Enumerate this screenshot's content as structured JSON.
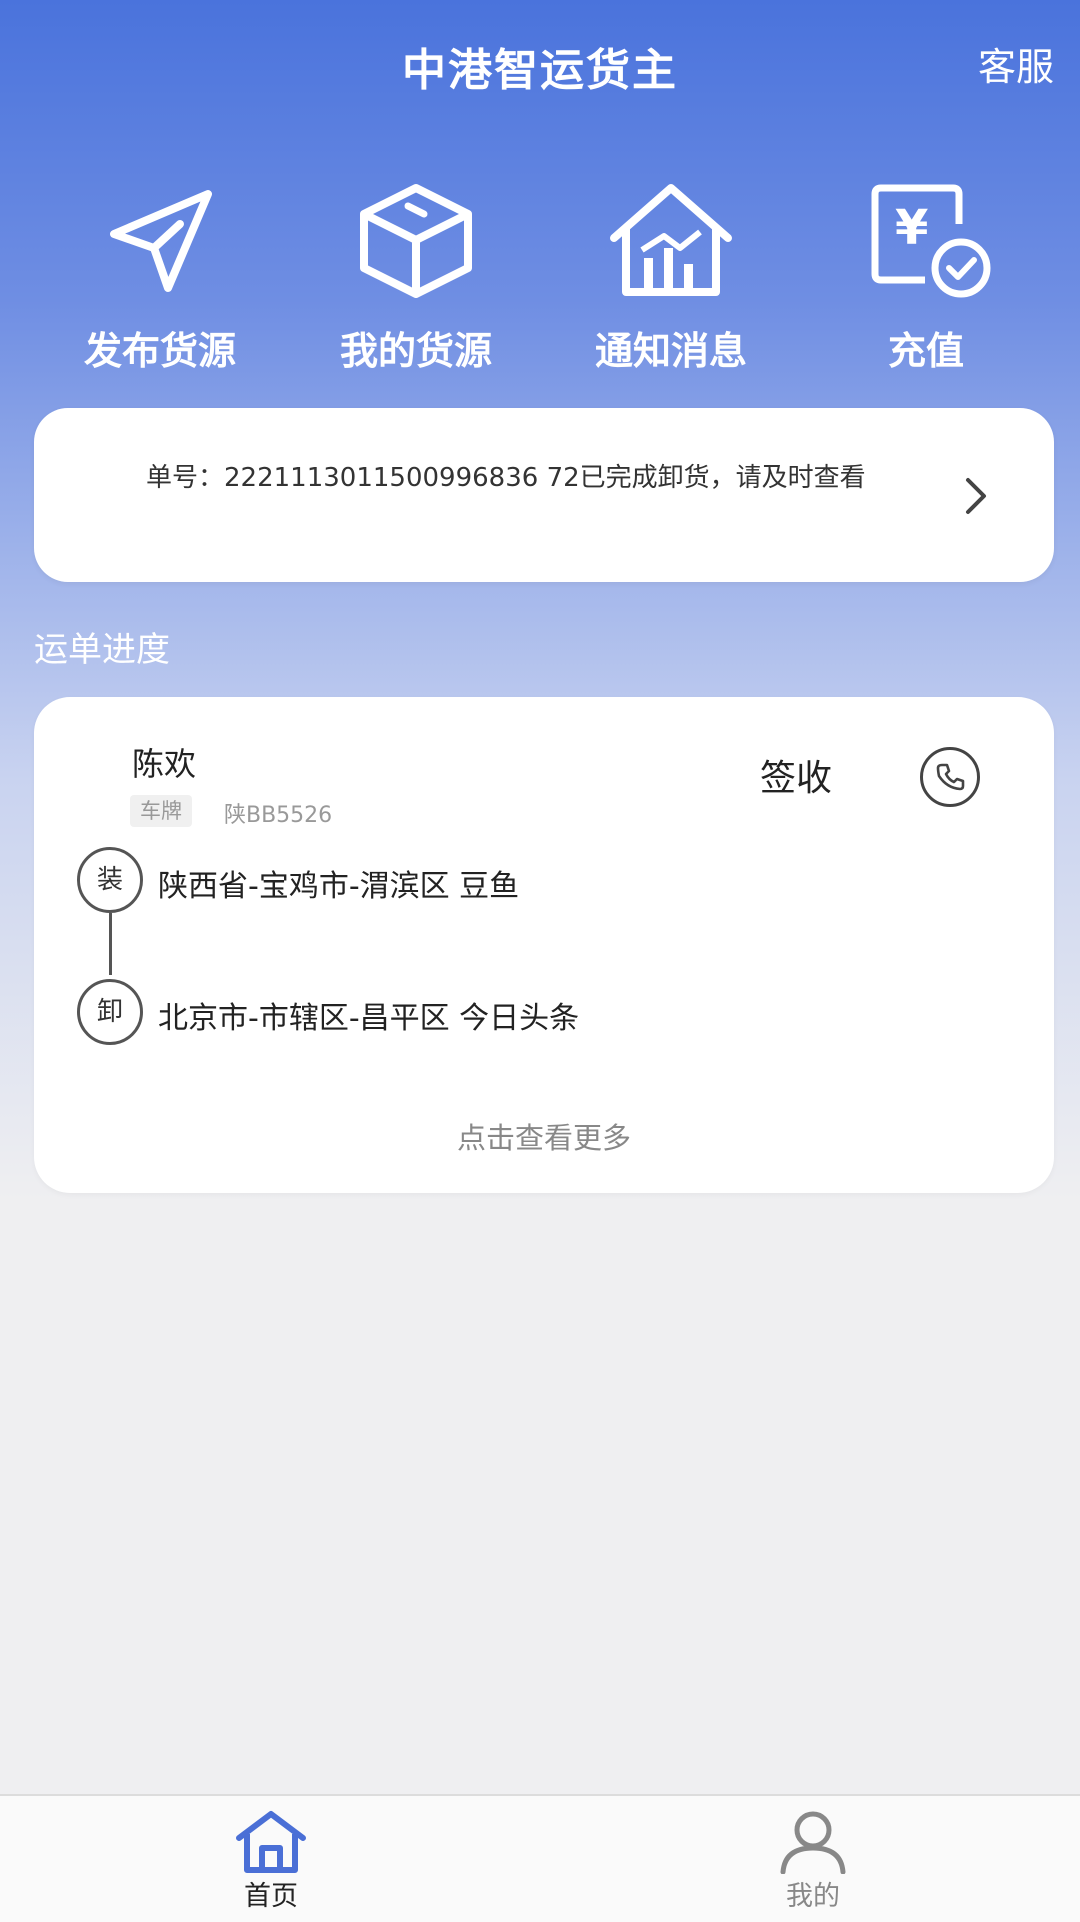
{
  "header": {
    "title": "中港智运货主",
    "service_label": "客服"
  },
  "quick_actions": [
    {
      "label": "发布货源",
      "icon": "send-icon"
    },
    {
      "label": "我的货源",
      "icon": "box-icon"
    },
    {
      "label": "通知消息",
      "icon": "house-chart-icon"
    },
    {
      "label": "充值",
      "icon": "recharge-icon"
    }
  ],
  "notice": {
    "text": "单号：2221113011500996836 72已完成卸货，请及时查看"
  },
  "section": {
    "title": "运单进度"
  },
  "order": {
    "driver_name": "陈欢",
    "plate_tag": "车牌",
    "plate_number": "陕BB5526",
    "status": "签收",
    "load_tag": "装",
    "load_address": "陕西省-宝鸡市-渭滨区 豆鱼",
    "unload_tag": "卸",
    "unload_address": "北京市-市辖区-昌平区 今日头条",
    "more_label": "点击查看更多"
  },
  "tabbar": {
    "items": [
      {
        "label": "首页",
        "icon": "home-icon",
        "active": true
      },
      {
        "label": "我的",
        "icon": "user-icon",
        "active": false
      }
    ]
  },
  "colors": {
    "accent": "#4a73dc",
    "tab_active": "#4a6fd6"
  }
}
